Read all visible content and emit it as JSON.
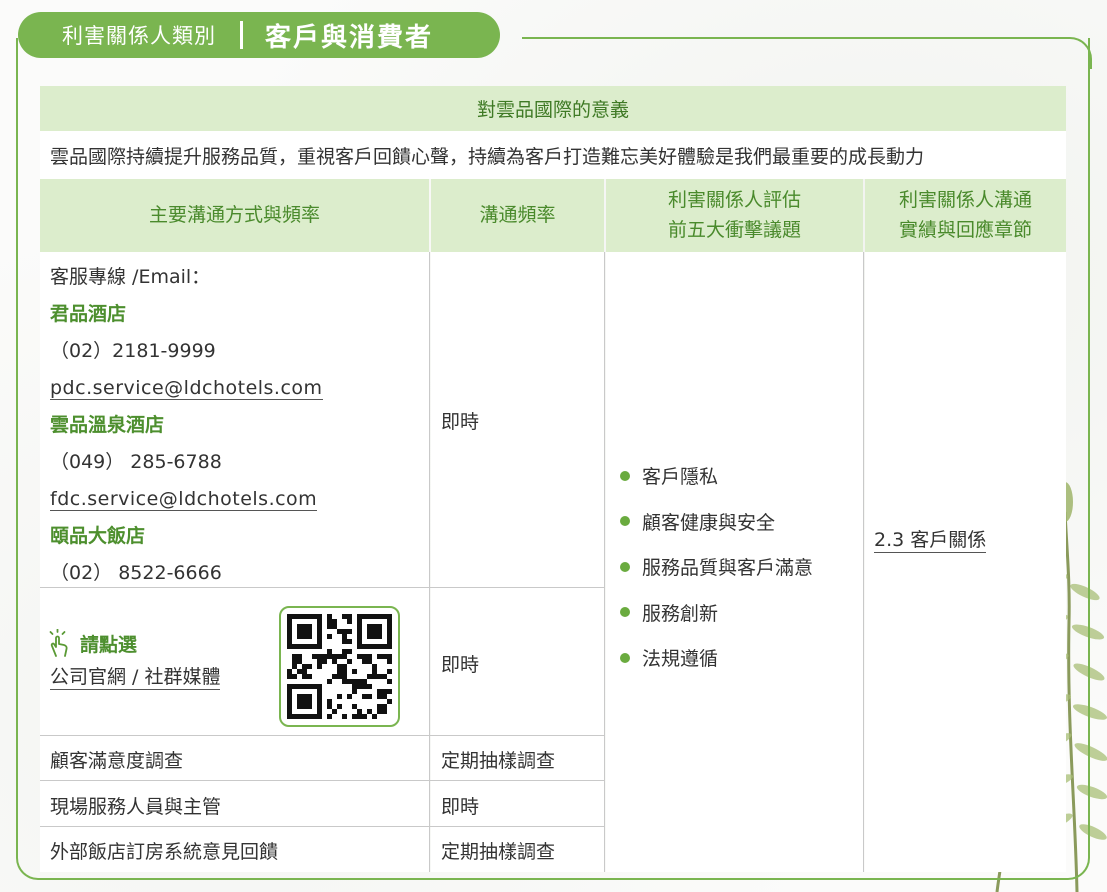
{
  "header": {
    "category_label": "利害關係人類別",
    "title": "客戶與消費者"
  },
  "meaning": {
    "title": "對雲品國際的意義",
    "text": "雲品國際持續提升服務品質，重視客戶回饋心聲，持續為客戶打造難忘美好體驗是我們最重要的成長動力"
  },
  "table": {
    "headers": {
      "channel": "主要溝通方式與頻率",
      "frequency": "溝通頻率",
      "issues_line1": "利害關係人評估",
      "issues_line2": "前五大衝擊議題",
      "response_line1": "利害關係人溝通",
      "response_line2": "實績與回應章節"
    },
    "contact": {
      "intro": "客服專線 /Email：",
      "hotel1_name": "君品酒店",
      "hotel1_phone": "（02）2181-9999",
      "hotel1_email": "pdc.service@ldchotels.com",
      "hotel2_name": "雲品溫泉酒店",
      "hotel2_phone": "（049） 285-6788",
      "hotel2_email": "fdc.service@ldchotels.com ",
      "hotel3_name": "頤品大飯店",
      "hotel3_phone": "（02） 8522-6666",
      "frequency": "即時"
    },
    "website": {
      "click_label": "請點選",
      "link_text": "公司官網 / 社群媒體",
      "frequency": "即時"
    },
    "rows": [
      {
        "channel": "顧客滿意度調查",
        "frequency": "定期抽樣調查"
      },
      {
        "channel": "現場服務人員與主管",
        "frequency": "即時"
      },
      {
        "channel": "外部飯店訂房系統意見回饋",
        "frequency": "定期抽樣調查"
      }
    ],
    "issues": [
      "客戶隱私",
      "顧客健康與安全",
      "服務品質與客戶滿意",
      "服務創新",
      "法規遵循"
    ],
    "response_chapter": "2.3 客戶關係"
  },
  "colors": {
    "brand_green": "#7ab550",
    "header_fill": "#dcedcc",
    "text_green": "#4d8f2e"
  }
}
